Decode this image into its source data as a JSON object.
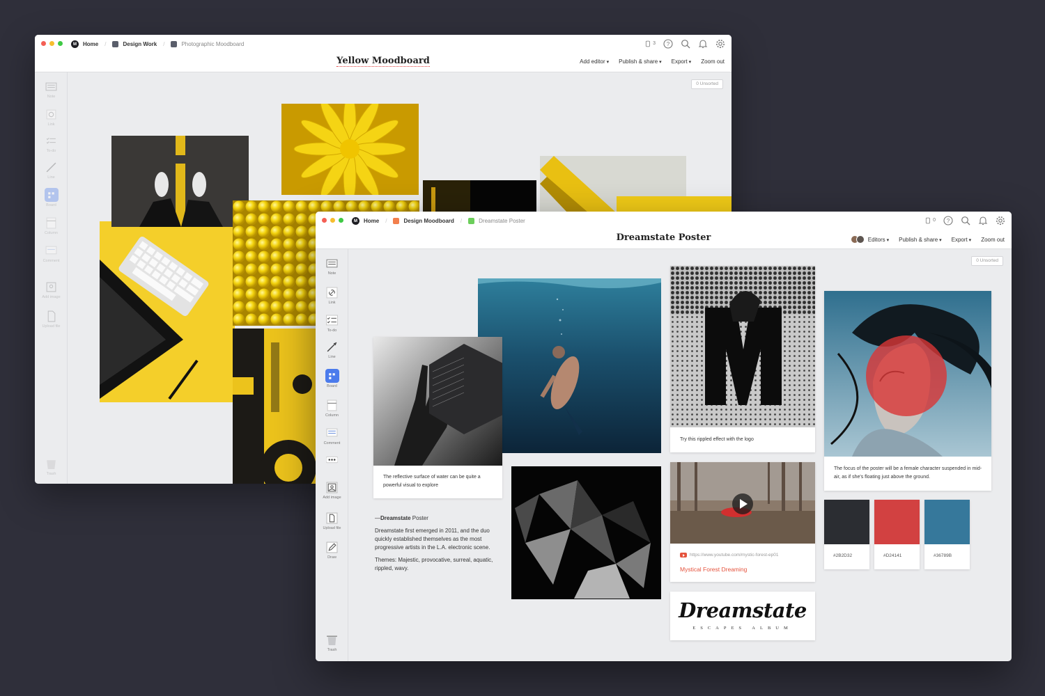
{
  "colors": {
    "desktop": "#2f2f3a",
    "accent_blue": "#4b7bec",
    "link_red": "#e5533d"
  },
  "window_back": {
    "breadcrumbs": [
      {
        "label": "Home",
        "icon": "home-icon"
      },
      {
        "label": "Design Work",
        "icon": "board-icon"
      },
      {
        "label": "Photographic Moodboard",
        "icon": "board-icon"
      }
    ],
    "title": "Yellow Moodboard",
    "device_count": "3",
    "menu": [
      "Add editor",
      "Publish & share",
      "Export",
      "Zoom out"
    ],
    "unsorted": "0 Unsorted",
    "tools": [
      "Note",
      "Link",
      "To-do",
      "Line",
      "Board",
      "Column",
      "Comment",
      "Add image",
      "Upload file"
    ],
    "trash": "Trash"
  },
  "window_front": {
    "breadcrumbs": [
      {
        "label": "Home",
        "icon": "home-icon"
      },
      {
        "label": "Design Moodboard",
        "icon": "board-icon"
      },
      {
        "label": "Dreamstate Poster",
        "icon": "board-icon"
      }
    ],
    "title": "Dreamstate Poster",
    "device_count": "0",
    "menu": [
      "Editors",
      "Publish & share",
      "Export",
      "Zoom out"
    ],
    "unsorted": "0 Unsorted",
    "tools": [
      "Note",
      "Link",
      "To-do",
      "Line",
      "Board",
      "Column",
      "Comment",
      "Add image",
      "Upload file",
      "Draw"
    ],
    "trash": "Trash",
    "captions": {
      "water": "The reflective surface of water can be quite a powerful visual to explore",
      "ripple": "Try this rippled effect with the logo",
      "focus": "The focus of the poster will be a female character suspended in mid-air, as if  she's floating just above the ground."
    },
    "note": {
      "dash": "—",
      "bold": "Dreamstate",
      "heading_rest": " Poster",
      "p1": "Dreamstate first emerged in 2011, and the duo quickly established themselves as the most progressive artists in the L.A. electronic scene.",
      "p2": "Themes: Majestic, provocative, surreal, aquatic, rippled, wavy."
    },
    "video": {
      "url": "https://www.youtube.com/mystic-forest-ep01",
      "title": "Mystical Forest Dreaming"
    },
    "logo": {
      "main": "Dreamstate",
      "sub": "ESCAPES ALBUM"
    },
    "swatches": [
      {
        "hex": "#2B2D32",
        "label": "#2B2D32"
      },
      {
        "hex": "#D24141",
        "label": "#D24141"
      },
      {
        "hex": "#36789B",
        "label": "#36789B"
      }
    ]
  }
}
